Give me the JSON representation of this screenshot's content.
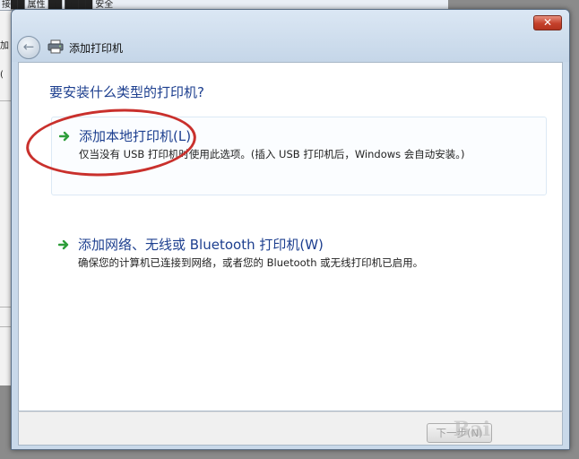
{
  "background": {
    "top_fragment": "接██ 属性 ██ ████ 安全",
    "left_fragments": [
      "加",
      "("
    ]
  },
  "window": {
    "title": "添加打印机",
    "close_glyph": "✕",
    "back_glyph": "←"
  },
  "content": {
    "heading": "要安装什么类型的打印机?",
    "options": [
      {
        "title": "添加本地打印机(L)",
        "description": "仅当没有 USB 打印机时使用此选项。(插入 USB 打印机后，Windows 会自动安装。)"
      },
      {
        "title": "添加网络、无线或 Bluetooth 打印机(W)",
        "description": "确保您的计算机已连接到网络，或者您的 Bluetooth 或无线打印机已启用。"
      }
    ]
  },
  "footer": {
    "next_label": "下一步(N)",
    "watermark": "Bai"
  },
  "colors": {
    "link_blue": "#1d3f8f",
    "arrow_green": "#2e9e3a",
    "annotation_red": "#c9302c"
  }
}
